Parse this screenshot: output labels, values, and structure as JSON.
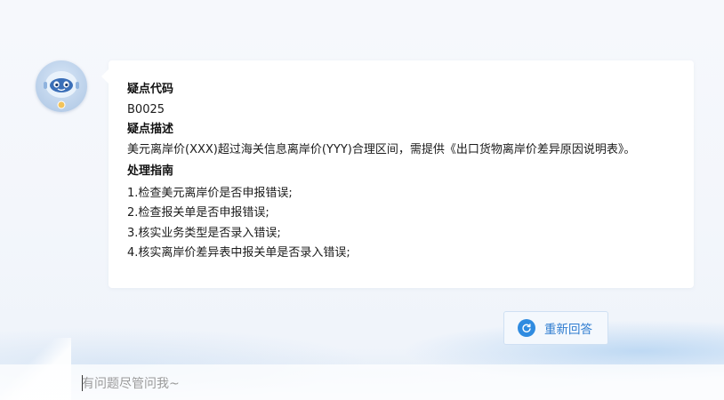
{
  "message": {
    "code_heading": "疑点代码",
    "code_value": "B0025",
    "desc_heading": "疑点描述",
    "desc_text": "美元离岸价(XXX)超过海关信息离岸价(YYY)合理区间，需提供《出口货物离岸价差异原因说明表》。",
    "guide_heading": "处理指南",
    "guide_items": [
      "1.检查美元离岸价是否申报错误;",
      "2.检查报关单是否申报错误;",
      "3.核实业务类型是否录入错误;",
      "4.核实离岸价差异表中报关单是否录入错误;"
    ]
  },
  "retry_button": {
    "label": "重新回答",
    "icon": "refresh-icon",
    "accent": "#2f8be0"
  },
  "input": {
    "placeholder": "有问题尽管问我~",
    "value": ""
  },
  "avatar": {
    "icon": "robot-assistant-icon"
  }
}
